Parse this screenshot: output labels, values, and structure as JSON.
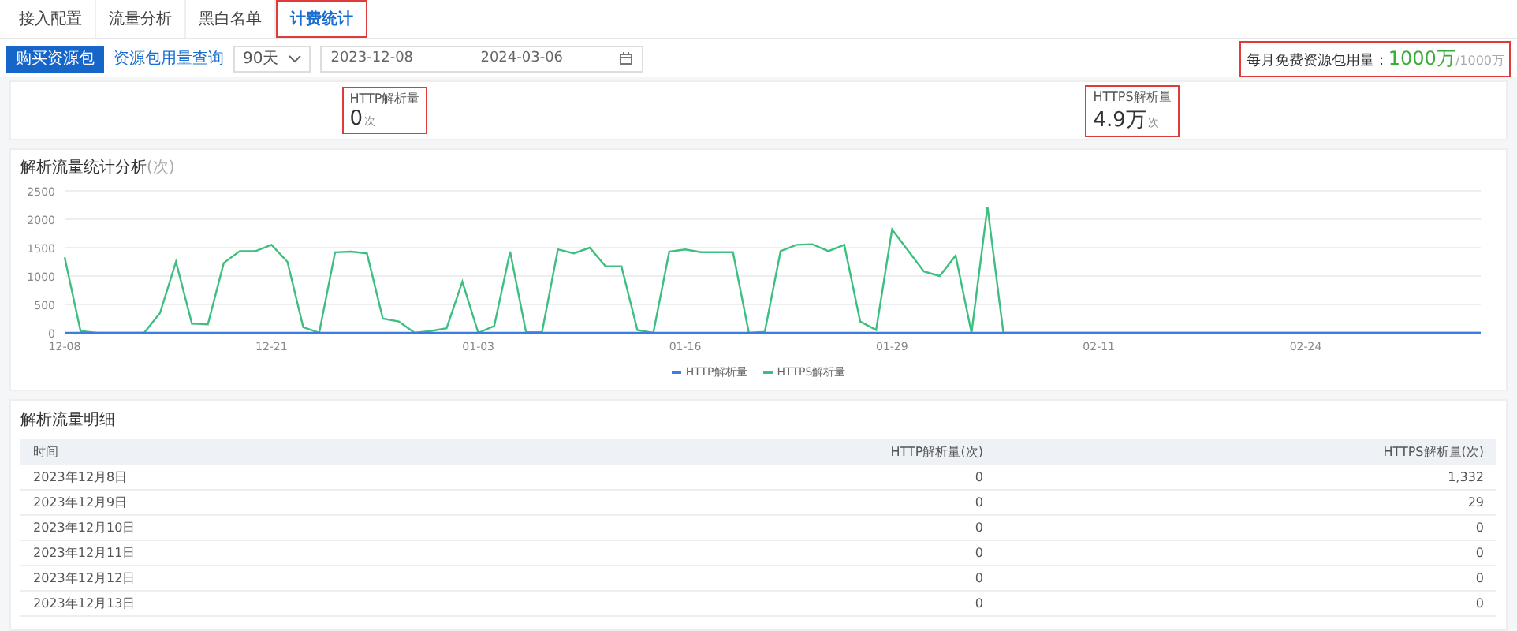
{
  "tabs": [
    {
      "label": "接入配置",
      "selected": false,
      "highlighted": false
    },
    {
      "label": "流量分析",
      "selected": false,
      "highlighted": false
    },
    {
      "label": "黑白名单",
      "selected": false,
      "highlighted": false
    },
    {
      "label": "计费统计",
      "selected": true,
      "highlighted": true
    }
  ],
  "toolbar": {
    "buy_button": "购买资源包",
    "usage_link": "资源包用量查询",
    "period_select": "90天",
    "date_start": "2023-12-08",
    "date_end": "2024-03-06",
    "quota": {
      "label": "每月免费资源包用量：",
      "value": "1000万",
      "total": "/1000万",
      "highlighted": true
    }
  },
  "stats": [
    {
      "label": "HTTP解析量",
      "value": "0",
      "unit": "次",
      "highlighted": true
    },
    {
      "label": "HTTPS解析量",
      "value": "4.9万",
      "unit": "次",
      "highlighted": true
    }
  ],
  "chart": {
    "title": "解析流量统计分析",
    "title_unit": "(次)",
    "chart_data": {
      "type": "line",
      "categories": [
        "12-08",
        null,
        null,
        null,
        null,
        null,
        null,
        null,
        null,
        null,
        null,
        null,
        null,
        "12-21",
        null,
        null,
        null,
        null,
        null,
        null,
        null,
        null,
        null,
        null,
        null,
        null,
        "01-03",
        null,
        null,
        null,
        null,
        null,
        null,
        null,
        null,
        null,
        null,
        null,
        null,
        "01-16",
        null,
        null,
        null,
        null,
        null,
        null,
        null,
        null,
        null,
        null,
        null,
        null,
        "01-29",
        null,
        null,
        null,
        null,
        null,
        null,
        null,
        null,
        null,
        null,
        null,
        null,
        "02-11",
        null,
        null,
        null,
        null,
        null,
        null,
        null,
        null,
        null,
        null,
        null,
        null,
        "02-24",
        null,
        null,
        null,
        null,
        null,
        null,
        null,
        null,
        null,
        null,
        null
      ],
      "grid": true,
      "ylim": [
        0,
        2500
      ],
      "yticks": [
        0,
        500,
        1000,
        1500,
        2000,
        2500
      ],
      "series": [
        {
          "name": "HTTP解析量",
          "color": "#3b7de0",
          "values": [
            0,
            0,
            0,
            0,
            0,
            0,
            0,
            0,
            0,
            0,
            0,
            0,
            0,
            0,
            0,
            0,
            0,
            0,
            0,
            0,
            0,
            0,
            0,
            0,
            0,
            0,
            0,
            0,
            0,
            0,
            0,
            0,
            0,
            0,
            0,
            0,
            0,
            0,
            0,
            0,
            0,
            0,
            0,
            0,
            0,
            0,
            0,
            0,
            0,
            0,
            0,
            0,
            0,
            0,
            0,
            0,
            0,
            0,
            0,
            0,
            0,
            0,
            0,
            0,
            0,
            0,
            0,
            0,
            0,
            0,
            0,
            0,
            0,
            0,
            0,
            0,
            0,
            0,
            0,
            0,
            0,
            0,
            0,
            0,
            0,
            0,
            0,
            0,
            0,
            0
          ]
        },
        {
          "name": "HTTPS解析量",
          "color": "#3dbf7f",
          "values": [
            1330,
            30,
            0,
            0,
            0,
            0,
            350,
            1250,
            160,
            150,
            1230,
            1440,
            1440,
            1550,
            1250,
            100,
            0,
            1420,
            1430,
            1400,
            250,
            200,
            0,
            30,
            80,
            900,
            0,
            120,
            1430,
            10,
            10,
            1470,
            1400,
            1500,
            1170,
            1170,
            50,
            0,
            1430,
            1470,
            1420,
            1420,
            1420,
            0,
            20,
            1440,
            1550,
            1560,
            1440,
            1550,
            200,
            50,
            1820,
            1450,
            1080,
            1000,
            1360,
            0,
            2220,
            0,
            0,
            0,
            0,
            0,
            0,
            0,
            0,
            0,
            0,
            0,
            0,
            0,
            0,
            0,
            0,
            0,
            0,
            0,
            0,
            0,
            0,
            0,
            0,
            0,
            0,
            0,
            0,
            0,
            0,
            0
          ]
        }
      ]
    }
  },
  "table": {
    "title": "解析流量明细",
    "columns": [
      "时间",
      "HTTP解析量(次)",
      "HTTPS解析量(次)"
    ],
    "rows": [
      [
        "2023年12月8日",
        "0",
        "1,332"
      ],
      [
        "2023年12月9日",
        "0",
        "29"
      ],
      [
        "2023年12月10日",
        "0",
        "0"
      ],
      [
        "2023年12月11日",
        "0",
        "0"
      ],
      [
        "2023年12月12日",
        "0",
        "0"
      ],
      [
        "2023年12月13日",
        "0",
        "0"
      ]
    ]
  }
}
